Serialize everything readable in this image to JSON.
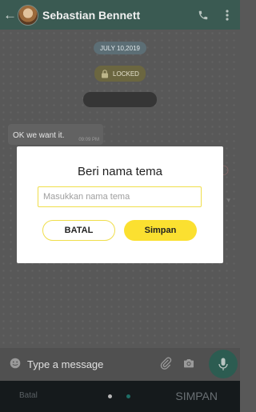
{
  "header": {
    "contact_name": "Sebastian Bennett"
  },
  "chat": {
    "date_label": "JULY 10,2019",
    "locked_label": "LOCKED",
    "messages": [
      {
        "text": "OK we want it.",
        "time": "09:09 PM"
      }
    ]
  },
  "composer": {
    "placeholder": "Type a message"
  },
  "bottom_bar": {
    "batal_label": "Batal",
    "simpan_label": "SIMPAN",
    "pager_total": 2,
    "pager_current": 2
  },
  "dialog": {
    "title": "Beri nama tema",
    "input_placeholder": "Masukkan nama tema",
    "input_value": "",
    "cancel_label": "BATAL",
    "save_label": "Simpan"
  },
  "colors": {
    "accent_yellow": "#fbe030",
    "header_teal": "#3a5a52",
    "mic_green": "#2c5c51"
  }
}
